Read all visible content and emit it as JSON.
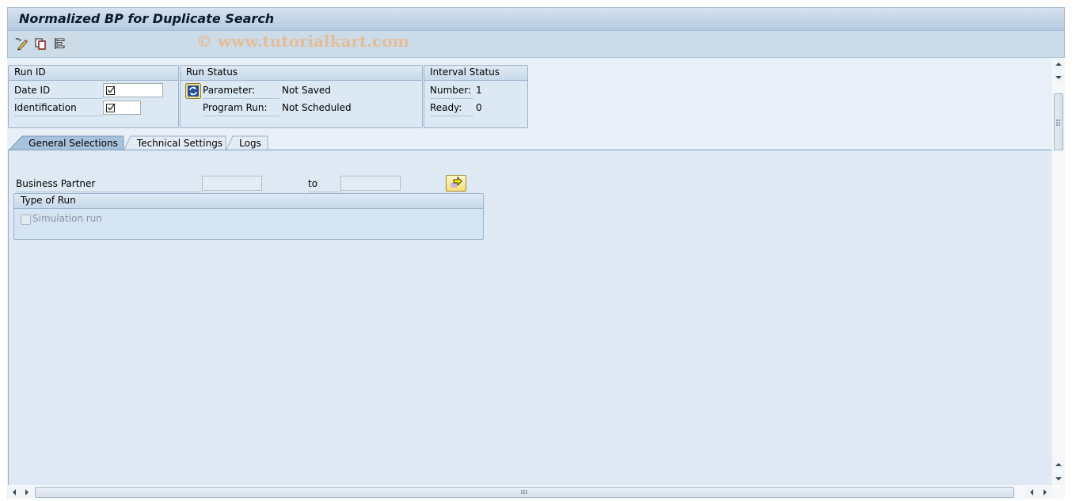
{
  "window": {
    "title": "Normalized BP for Duplicate Search",
    "watermark": "© www.tutorialkart.com"
  },
  "toolbar": {
    "icons": [
      {
        "name": "change-icon",
        "tooltip": "Change"
      },
      {
        "name": "copy-icon",
        "tooltip": "Copy"
      },
      {
        "name": "structure-icon",
        "tooltip": "Display structure"
      }
    ]
  },
  "run_id": {
    "header": "Run ID",
    "fields": [
      {
        "label": "Date ID",
        "value": "☑"
      },
      {
        "label": "Identification",
        "value": "☑"
      }
    ]
  },
  "run_status": {
    "header": "Run Status",
    "rows": [
      {
        "label": "Parameter:",
        "value": "Not Saved"
      },
      {
        "label": "Program Run:",
        "value": "Not Scheduled"
      }
    ],
    "refresh_icon": "refresh-icon"
  },
  "interval_status": {
    "header": "Interval Status",
    "rows": [
      {
        "label": "Number:",
        "value": "1"
      },
      {
        "label": "Ready:",
        "value": "0"
      }
    ]
  },
  "tabs": [
    {
      "label": "General Selections",
      "active": true
    },
    {
      "label": "Technical Settings",
      "active": false
    },
    {
      "label": "Logs",
      "active": false
    }
  ],
  "general_selections": {
    "business_partner": {
      "label": "Business Partner",
      "from_value": "",
      "to_label": "to",
      "to_value": "",
      "multiple_selection_icon": "multiple-selection-arrow-icon"
    },
    "type_of_run": {
      "header": "Type of Run",
      "simulation_run": {
        "label": "Simulation run",
        "checked": false,
        "disabled": true
      }
    }
  },
  "colors": {
    "title_bar": "#c4d5e8",
    "background": "#dee9f4",
    "tab_active": "#a9c2de",
    "watermark": "#e8b88a"
  }
}
